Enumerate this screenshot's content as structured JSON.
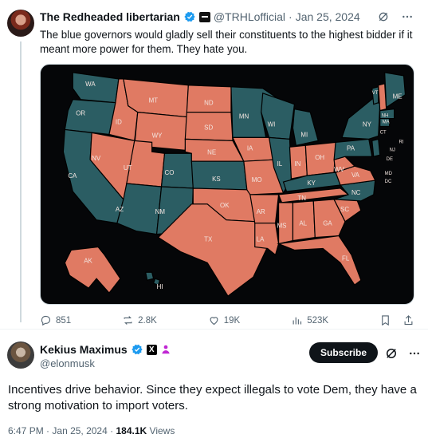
{
  "quoted_tweet": {
    "author_name": "The Redheaded libertarian",
    "handle": "@TRHLofficial",
    "date": "Jan 25, 2024",
    "separator": "·",
    "text": "The blue governors would gladly sell their constituents to the highest bidder if it meant more power for them. They hate you.",
    "map_labels": {
      "WA": "WA",
      "OR": "OR",
      "CA": "CA",
      "ID": "ID",
      "NV": "NV",
      "MT": "MT",
      "WY": "WY",
      "UT": "UT",
      "AZ": "AZ",
      "CO": "CO",
      "NM": "NM",
      "ND": "ND",
      "SD": "SD",
      "NE": "NE",
      "KS": "KS",
      "OK": "OK",
      "TX": "TX",
      "MN": "MN",
      "IA": "IA",
      "MO": "MO",
      "AR": "AR",
      "LA": "LA",
      "WI": "WI",
      "IL": "IL",
      "MI": "MI",
      "IN": "IN",
      "OH": "OH",
      "KY": "KY",
      "TN": "TN",
      "MS": "MS",
      "AL": "AL",
      "GA": "GA",
      "FL": "FL",
      "SC": "SC",
      "NC": "NC",
      "VA": "VA",
      "WV": "WV",
      "PA": "PA",
      "NY": "NY",
      "VT": "VT",
      "NH": "NH",
      "ME": "ME",
      "MA": "MA",
      "CT": "CT",
      "RI": "RI",
      "NJ": "NJ",
      "DE": "DE",
      "MD": "MD",
      "DC": "DC",
      "AK": "AK",
      "HI": "HI"
    },
    "colors": {
      "red": "#e07a63",
      "teal": "#2b5d63",
      "background": "#050608"
    },
    "actions": {
      "replies": "851",
      "reposts": "2.8K",
      "likes": "19K",
      "views": "523K"
    }
  },
  "main_tweet": {
    "author_name": "Kekius Maximus",
    "handle": "@elonmusk",
    "x_badge": "X",
    "subscribe_label": "Subscribe",
    "text": "Incentives drive behavior. Since they expect illegals to vote Dem, they have a strong motivation to import voters.",
    "time": "6:47 PM",
    "date": "Jan 25, 2024",
    "separator": "·",
    "views_count": "184.1K",
    "views_label": "Views"
  },
  "icons": [
    "verified-icon",
    "affiliate-badge-icon",
    "grok-icon",
    "more-icon",
    "reply-icon",
    "repost-icon",
    "like-icon",
    "views-icon",
    "bookmark-icon",
    "share-icon",
    "x-badge-icon",
    "person-icon"
  ]
}
